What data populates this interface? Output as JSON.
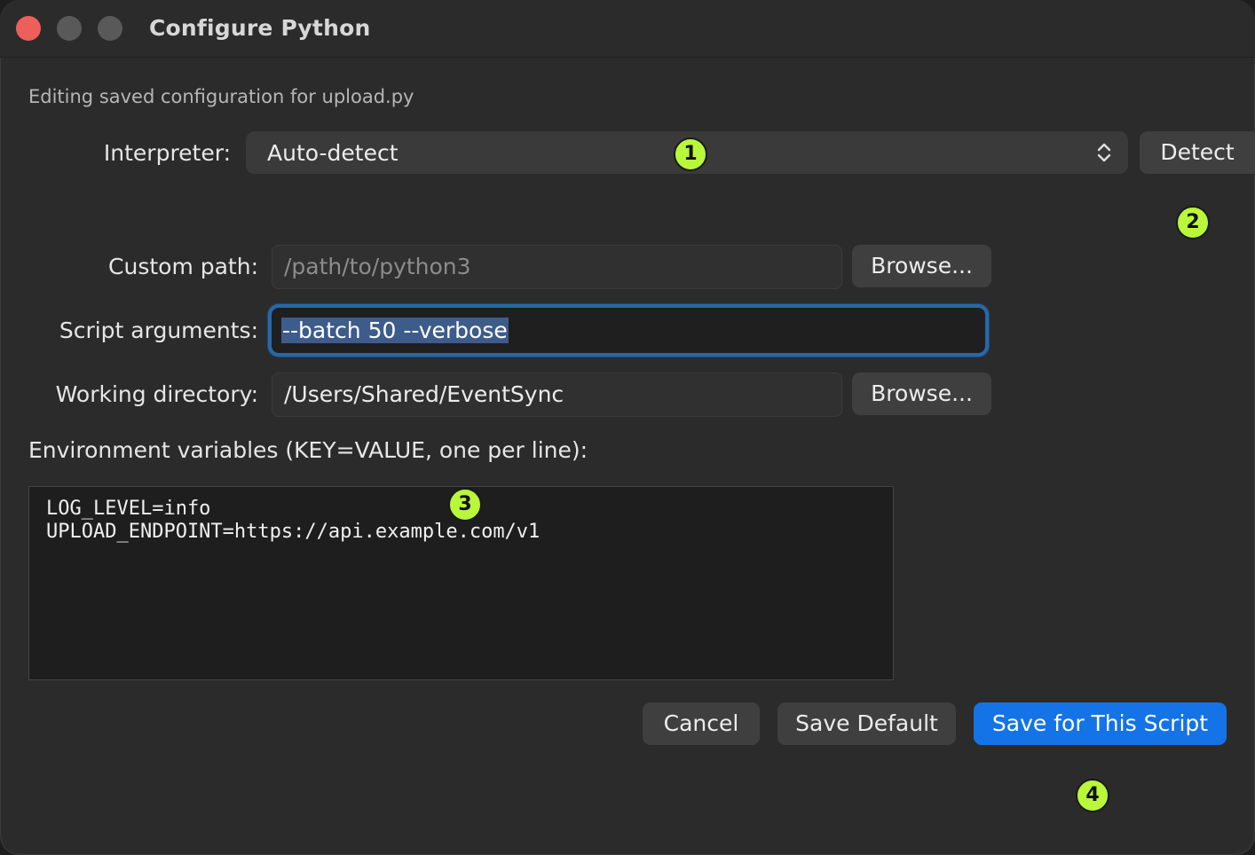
{
  "window": {
    "title": "Configure Python",
    "subtitle": "Editing saved configuration for upload.py"
  },
  "interpreter": {
    "label": "Interpreter:",
    "selected": "Auto-detect",
    "detect_label": "Detect"
  },
  "custom_path": {
    "label": "Custom path:",
    "placeholder": "/path/to/python3",
    "browse_label": "Browse..."
  },
  "script_arguments": {
    "label": "Script arguments:",
    "value": "--batch 50 --verbose"
  },
  "working_directory": {
    "label": "Working directory:",
    "value": "/Users/Shared/EventSync",
    "browse_label": "Browse..."
  },
  "environment": {
    "label": "Environment variables (KEY=VALUE, one per line):",
    "lines": [
      "LOG_LEVEL=info",
      "UPLOAD_ENDPOINT=https://api.example.com/v1"
    ]
  },
  "footer": {
    "cancel_label": "Cancel",
    "save_default_label": "Save Default",
    "save_script_label": "Save for This Script"
  },
  "annotations": [
    "1",
    "2",
    "3",
    "4"
  ],
  "colors": {
    "primary": "#1473e6",
    "close_light": "#ec5f5a",
    "focus_ring": "#2a67a6",
    "badge": "#b8f73a"
  }
}
